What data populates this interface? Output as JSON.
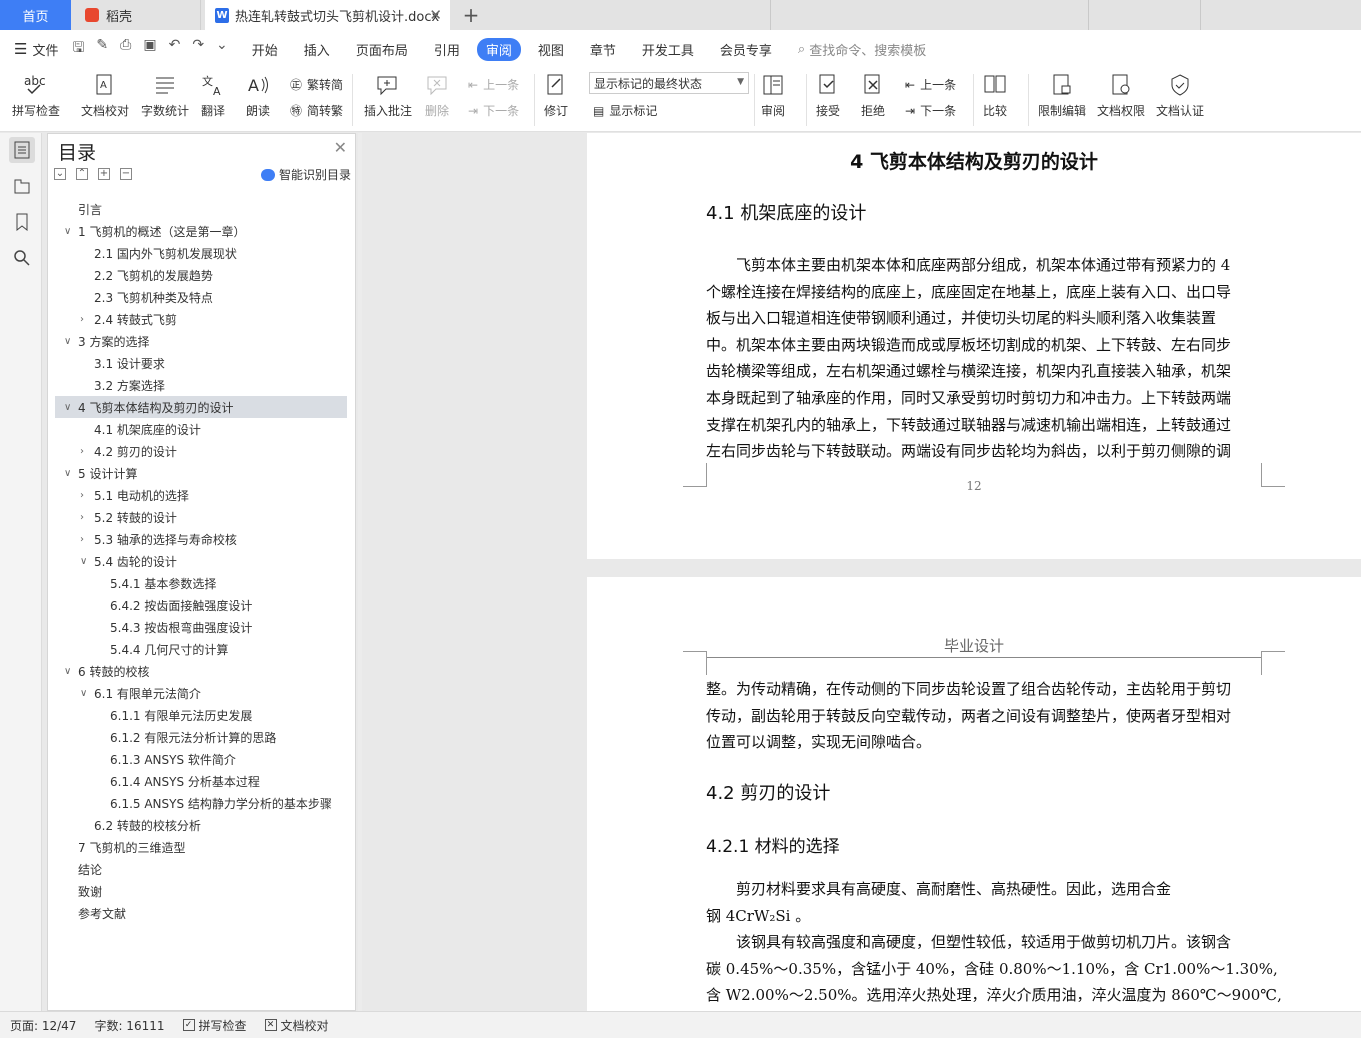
{
  "tabs": {
    "home": "首页",
    "wps": "稻壳",
    "doc": "热连轧转鼓式切头飞剪机设计.docx"
  },
  "menu": {
    "file": "文件",
    "items": [
      "开始",
      "插入",
      "页面布局",
      "引用",
      "审阅",
      "视图",
      "章节",
      "开发工具",
      "会员专享"
    ],
    "active": "审阅",
    "search": "查找命令、搜索模板"
  },
  "toolbar": {
    "spell": "拼写检查",
    "proof": "文档校对",
    "wordcount": "字数统计",
    "translate": "翻译",
    "read": "朗读",
    "trad": "繁转简",
    "simp": "简转繁",
    "add_comment": "插入批注",
    "delete": "删除",
    "prev_comment": "上一条",
    "next_comment": "下一条",
    "track": "修订",
    "markup_state": "显示标记的最终状态",
    "show_markup": "显示标记",
    "review": "审阅",
    "accept": "接受",
    "reject": "拒绝",
    "prev_change": "上一条",
    "next_change": "下一条",
    "compare": "比较",
    "restrict": "限制编辑",
    "permission": "文档权限",
    "certify": "文档认证"
  },
  "toc": {
    "title": "目录",
    "ai": "智能识别目录",
    "items": [
      {
        "text": "引言",
        "level": 0,
        "chev": ""
      },
      {
        "text": "1 飞剪机的概述（这是第一章）",
        "level": 0,
        "chev": "open"
      },
      {
        "text": "2.1 国内外飞剪机发展现状",
        "level": 1,
        "chev": ""
      },
      {
        "text": "2.2 飞剪机的发展趋势",
        "level": 1,
        "chev": ""
      },
      {
        "text": "2.3 飞剪机种类及特点",
        "level": 1,
        "chev": ""
      },
      {
        "text": "2.4  转鼓式飞剪",
        "level": 1,
        "chev": "closed"
      },
      {
        "text": "3  方案的选择",
        "level": 0,
        "chev": "open"
      },
      {
        "text": "3.1  设计要求",
        "level": 1,
        "chev": ""
      },
      {
        "text": "3.2  方案选择",
        "level": 1,
        "chev": ""
      },
      {
        "text": "4 飞剪本体结构及剪刃的设计",
        "level": 0,
        "chev": "open",
        "selected": true
      },
      {
        "text": "4.1 机架底座的设计",
        "level": 1,
        "chev": ""
      },
      {
        "text": "4.2 剪刃的设计",
        "level": 1,
        "chev": "closed"
      },
      {
        "text": "5  设计计算",
        "level": 0,
        "chev": "open"
      },
      {
        "text": "5.1 电动机的选择",
        "level": 1,
        "chev": "closed"
      },
      {
        "text": "5.2  转鼓的设计",
        "level": 1,
        "chev": "closed"
      },
      {
        "text": "5.3 轴承的选择与寿命校核",
        "level": 1,
        "chev": "closed"
      },
      {
        "text": "5.4  齿轮的设计",
        "level": 1,
        "chev": "open"
      },
      {
        "text": "5.4.1  基本参数选择",
        "level": 2,
        "chev": ""
      },
      {
        "text": "6.4.2  按齿面接触强度设计",
        "level": 2,
        "chev": ""
      },
      {
        "text": "5.4.3 按齿根弯曲强度设计",
        "level": 2,
        "chev": ""
      },
      {
        "text": "5.4.4  几何尺寸的计算",
        "level": 2,
        "chev": ""
      },
      {
        "text": "6  转鼓的校核",
        "level": 0,
        "chev": "open"
      },
      {
        "text": "6.1 有限单元法简介",
        "level": 1,
        "chev": "open"
      },
      {
        "text": "6.1.1  有限单元法历史发展",
        "level": 2,
        "chev": ""
      },
      {
        "text": "6.1.2 有限元法分析计算的思路",
        "level": 2,
        "chev": ""
      },
      {
        "text": "6.1.3    ANSYS 软件简介",
        "level": 2,
        "chev": ""
      },
      {
        "text": "6.1.4    ANSYS 分析基本过程",
        "level": 2,
        "chev": ""
      },
      {
        "text": "6.1.5 ANSYS 结构静力学分析的基本步骤",
        "level": 2,
        "chev": ""
      },
      {
        "text": "6.2  转鼓的校核分析",
        "level": 1,
        "chev": ""
      },
      {
        "text": "7 飞剪机的三维造型",
        "level": 0,
        "chev": ""
      },
      {
        "text": "结论",
        "level": 0,
        "chev": ""
      },
      {
        "text": "致谢",
        "level": 0,
        "chev": ""
      },
      {
        "text": "参考文献",
        "level": 0,
        "chev": ""
      }
    ]
  },
  "page1": {
    "chapter": "4 飞剪本体结构及剪刃的设计",
    "section": "4.1 机架底座的设计",
    "lines": [
      "　　飞剪本体主要由机架本体和底座两部分组成，机架本体通过带有预紧力的 4",
      "个螺栓连接在焊接结构的底座上，底座固定在地基上，底座上装有入口、出口导",
      "板与出入口辊道相连使带钢顺利通过，并使切头切尾的料头顺利落入收集装置",
      "中。机架本体主要由两块锻造而成或厚板坯切割成的机架、上下转鼓、左右同步",
      "齿轮横梁等组成，左右机架通过螺栓与横梁连接，机架内孔直接装入轴承，机架",
      "本身既起到了轴承座的作用，同时又承受剪切时剪切力和冲击力。上下转鼓两端",
      "支撑在机架孔内的轴承上，下转鼓通过联轴器与减速机输出端相连，上转鼓通过",
      "左右同步齿轮与下转鼓联动。两端设有同步齿轮均为斜齿，以利于剪刃侧隙的调"
    ],
    "page_number": "12"
  },
  "page2": {
    "header": "毕业设计",
    "lines1": [
      "整。为传动精确，在传动侧的下同步齿轮设置了组合齿轮传动，主齿轮用于剪切",
      "传动，副齿轮用于转鼓反向空载传动，两者之间设有调整垫片，使两者牙型相对",
      "位置可以调整，实现无间隙啮合。"
    ],
    "section": "4.2 剪刃的设计",
    "subsection": "4.2.1 材料的选择",
    "lines2": [
      "　　剪刃材料要求具有高硬度、高耐磨性、高热硬性。因此，选用合金",
      "钢 4CrW₂Si 。",
      "　　该钢具有较高强度和高硬度，但塑性较低，较适用于做剪切机刀片。该钢含",
      "碳 0.45%～0.35%，含锰小于 40%，含硅 0.80%～1.10%，含 Cr1.00%～1.30%,",
      "含 W2.00%～2.50%。选用淬火热处理，淬火介质用油，淬火温度为 860℃～900℃,"
    ]
  },
  "status": {
    "page": "页面: 12/47",
    "words": "字数: 16111",
    "spell": "拼写检查",
    "proof": "文档校对"
  },
  "colors": {
    "accent": "#3e7ef5",
    "toc_selected": "#d9dde3"
  }
}
